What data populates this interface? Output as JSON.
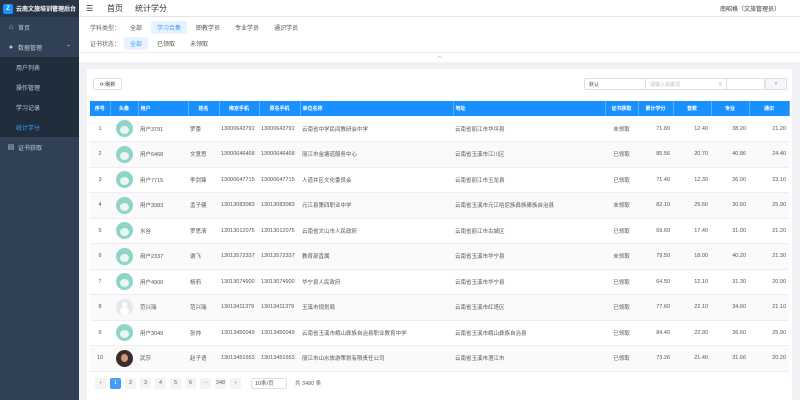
{
  "app": {
    "title": "云南文旅培训管理后台",
    "logo_glyph": "Z"
  },
  "sidebar": {
    "items": [
      {
        "label": "首页",
        "icon": "home-icon",
        "glyph": "⌂"
      },
      {
        "label": "数据管理",
        "icon": "user-icon",
        "glyph": "●",
        "expanded": true,
        "children": [
          {
            "label": "用户列表"
          },
          {
            "label": "操作管理"
          },
          {
            "label": "学习记录"
          },
          {
            "label": "统计学分",
            "active": true
          }
        ]
      },
      {
        "label": "证书获取",
        "icon": "doc-icon",
        "glyph": "▤"
      }
    ]
  },
  "topbar": {
    "home_tab": "首页",
    "current_tab": "统计学分",
    "user": "南昭格（文旅管理员）",
    "menu_glyph": "☰"
  },
  "filters": {
    "type_label": "学科类型：",
    "type_options": [
      "全部",
      "学习合集",
      "职教学员",
      "专业学员",
      "通识学员"
    ],
    "type_selected": "学习合集",
    "status_label": "证书状态：",
    "status_options": [
      "全部",
      "已领取",
      "未领取"
    ],
    "status_selected": "全部",
    "collapse_glyph": "︿"
  },
  "toolbar": {
    "refresh_label": "⟳ 刷新",
    "select_value": "默认",
    "select_caret": "∨",
    "search_placeholder": "请输入关键词",
    "search_glyph": "⌕"
  },
  "table": {
    "headers": [
      "序号",
      "头像",
      "用户",
      "姓名",
      "绑定手机",
      "原名手机",
      "单位名称",
      "地址",
      "证书获取",
      "累计学分",
      "普教",
      "专业",
      "通识"
    ],
    "rows": [
      {
        "no": "1",
        "avatar": "cartoon",
        "user": "用户3791",
        "name": "罗蕾",
        "phone": "13000643791",
        "phone2": "13000643791",
        "unit": "云南省中学民间教研会中学",
        "addr": "云南省丽江市华坪县",
        "cert": "未领取",
        "total": "71.80",
        "a": "12.40",
        "b": "38.20",
        "c": "21.20"
      },
      {
        "no": "2",
        "avatar": "cartoon",
        "user": "用户6468",
        "name": "文意思",
        "phone": "13000646468",
        "phone2": "13000646468",
        "unit": "丽江市金塘道服务中心",
        "addr": "云南省玉溪市江川区",
        "cert": "已领取",
        "total": "85.56",
        "a": "20.70",
        "b": "40.86",
        "c": "24.40"
      },
      {
        "no": "3",
        "avatar": "cartoon",
        "user": "用户7715",
        "name": "李剑锋",
        "phone": "13000647715",
        "phone2": "13000647715",
        "unit": "人道并区文化委员会",
        "addr": "云南省丽江市玉龙县",
        "cert": "已领取",
        "total": "71.40",
        "a": "12.30",
        "b": "36.00",
        "c": "23.10"
      },
      {
        "no": "4",
        "avatar": "cartoon",
        "user": "用户3083",
        "name": "孟子健",
        "phone": "13013083083",
        "phone2": "13013083083",
        "unit": "元江县第四职业中学",
        "addr": "云南省玉溪市元江哈尼族彝族傣族自治县",
        "cert": "未领取",
        "total": "82.10",
        "a": "25.60",
        "b": "30.60",
        "c": "25.90"
      },
      {
        "no": "5",
        "avatar": "cartoon",
        "user": "水谷",
        "name": "罗思清",
        "phone": "13013012075",
        "phone2": "13013012075",
        "unit": "云南省文山市人民政府",
        "addr": "云南省丽江市古城区",
        "cert": "已领取",
        "total": "69.60",
        "a": "17.40",
        "b": "31.00",
        "c": "21.20"
      },
      {
        "no": "6",
        "avatar": "cartoon",
        "user": "用户2337",
        "name": "谢飞",
        "phone": "13013572337",
        "phone2": "13013572337",
        "unit": "教育部直属",
        "addr": "云南省玉溪市华宁县",
        "cert": "未领取",
        "total": "79.50",
        "a": "18.00",
        "b": "40.20",
        "c": "21.30"
      },
      {
        "no": "7",
        "avatar": "cartoon",
        "user": "用户4900",
        "name": "杨莉",
        "phone": "13013074900",
        "phone2": "13013074900",
        "unit": "华宁县人民政府",
        "addr": "云南省玉溪市华宁县",
        "cert": "已领取",
        "total": "64.50",
        "a": "12.10",
        "b": "31.30",
        "c": "20.90"
      },
      {
        "no": "8",
        "avatar": "default",
        "user": "范兴瑞",
        "name": "范兴瑞",
        "phone": "13013411379",
        "phone2": "13013411379",
        "unit": "玉溪市规划局",
        "addr": "云南省玉溪市红塔区",
        "cert": "已领取",
        "total": "77.60",
        "a": "22.10",
        "b": "34.60",
        "c": "21.10"
      },
      {
        "no": "9",
        "avatar": "cartoon",
        "user": "用户3049",
        "name": "张帅",
        "phone": "13013450049",
        "phone2": "13013450049",
        "unit": "云南省玉溪市峨山彝族自治县职业教育中学",
        "addr": "云南省玉溪市峨山彝族自治县",
        "cert": "已领取",
        "total": "84.40",
        "a": "22.90",
        "b": "36.60",
        "c": "25.90"
      },
      {
        "no": "10",
        "avatar": "photo",
        "user": "武莎",
        "name": "赵子语",
        "phone": "13013451653",
        "phone2": "13013451653",
        "unit": "丽江市山水旅游策划有限责任公司",
        "addr": "云南省玉溪市澄江市",
        "cert": "已领取",
        "total": "73.26",
        "a": "21.40",
        "b": "31.66",
        "c": "20.20"
      }
    ]
  },
  "pagination": {
    "prev": "‹",
    "pages": [
      "1",
      "2",
      "3",
      "4",
      "5",
      "6",
      "···",
      "348"
    ],
    "current": "1",
    "next": "›",
    "page_size": "10条/页",
    "total": "共 3480 条"
  }
}
